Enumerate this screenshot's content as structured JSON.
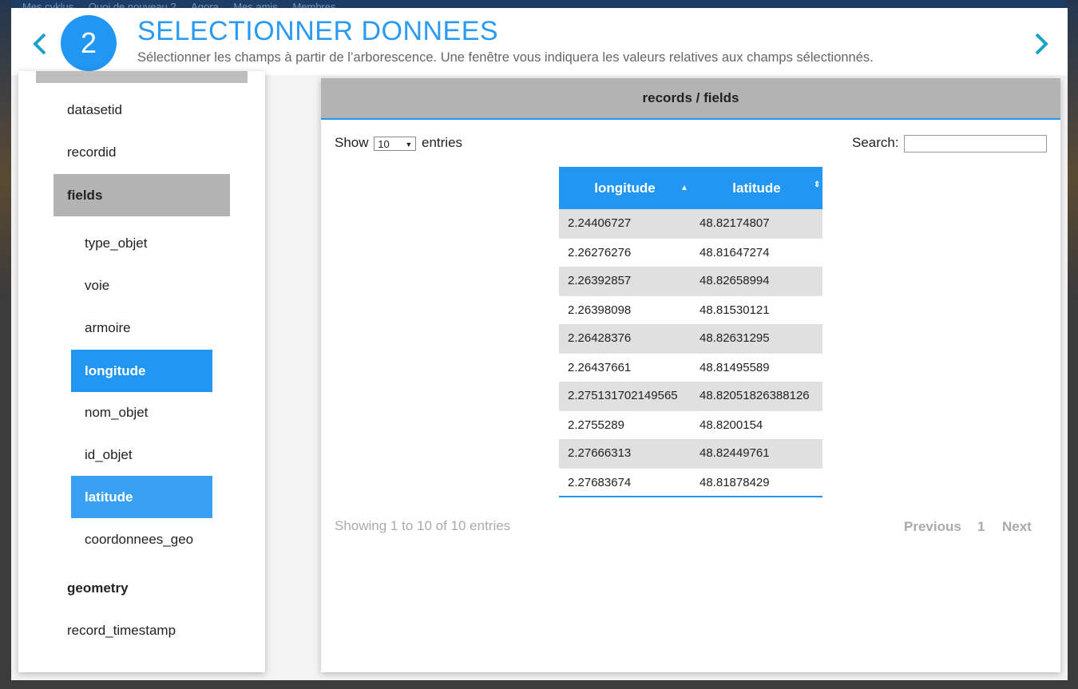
{
  "background_nav": [
    "Mes cyklus",
    "Quoi de nouveau ?",
    "Agora",
    "Mes amis",
    "Membres"
  ],
  "step": {
    "number": "2",
    "title": "SELECTIONNER DONNEES",
    "subtitle": "Sélectionner les champs à partir de l’arborescence. Une fenêtre vous indiquera les valeurs relatives aux champs sélectionnés."
  },
  "tree": {
    "datasetid": "datasetid",
    "recordid": "recordid",
    "fields": "fields",
    "type_objet": "type_objet",
    "voie": "voie",
    "armoire": "armoire",
    "longitude": "longitude",
    "nom_objet": "nom_objet",
    "id_objet": "id_objet",
    "latitude": "latitude",
    "coordonnees_geo": "coordonnees_geo",
    "geometry": "geometry",
    "record_timestamp": "record_timestamp"
  },
  "panel": {
    "title": "records / fields",
    "show_label": "Show",
    "entries_value": "10",
    "entries_label": "entries",
    "search_label": "Search:",
    "search_value": ""
  },
  "table": {
    "headers": [
      "longitude",
      "latitude"
    ],
    "rows": [
      [
        "2.24406727",
        "48.82174807"
      ],
      [
        "2.26276276",
        "48.81647274"
      ],
      [
        "2.26392857",
        "48.82658994"
      ],
      [
        "2.26398098",
        "48.81530121"
      ],
      [
        "2.26428376",
        "48.82631295"
      ],
      [
        "2.26437661",
        "48.81495589"
      ],
      [
        "2.275131702149565",
        "48.82051826388126"
      ],
      [
        "2.2755289",
        "48.8200154"
      ],
      [
        "2.27666313",
        "48.82449761"
      ],
      [
        "2.27683674",
        "48.81878429"
      ]
    ]
  },
  "footer": {
    "info": "Showing 1 to 10 of 10 entries",
    "previous": "Previous",
    "page": "1",
    "next": "Next"
  },
  "colors": {
    "accent": "#2196f3",
    "selected_grey": "#b3b3b3"
  }
}
